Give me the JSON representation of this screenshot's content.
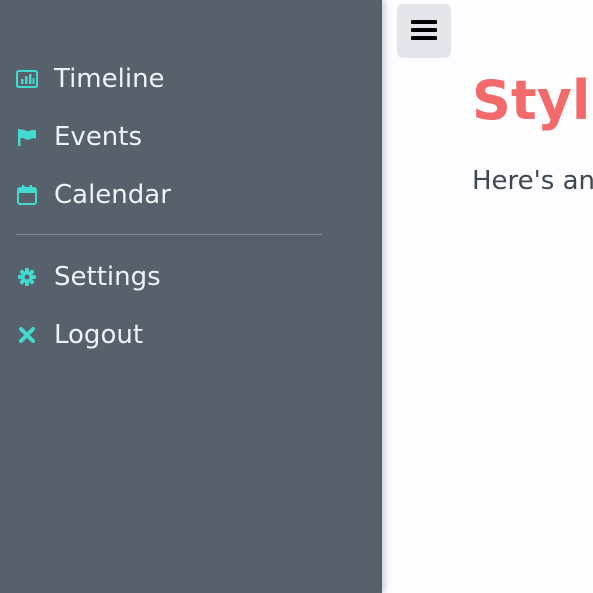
{
  "sidebar": {
    "items": [
      {
        "label": "Timeline",
        "icon": "bar-chart-icon"
      },
      {
        "label": "Events",
        "icon": "flag-icon"
      },
      {
        "label": "Calendar",
        "icon": "calendar-icon"
      },
      {
        "label": "Settings",
        "icon": "gear-icon"
      },
      {
        "label": "Logout",
        "icon": "close-icon"
      }
    ]
  },
  "main": {
    "menu_icon": "hamburger-menu-icon",
    "title": "Stylis",
    "text": "Here's an"
  },
  "colors": {
    "sidebar_bg": "#56616c",
    "accent": "#42d9cf",
    "title": "#f26a6a",
    "menu_button_bg": "#e3e5ea"
  }
}
